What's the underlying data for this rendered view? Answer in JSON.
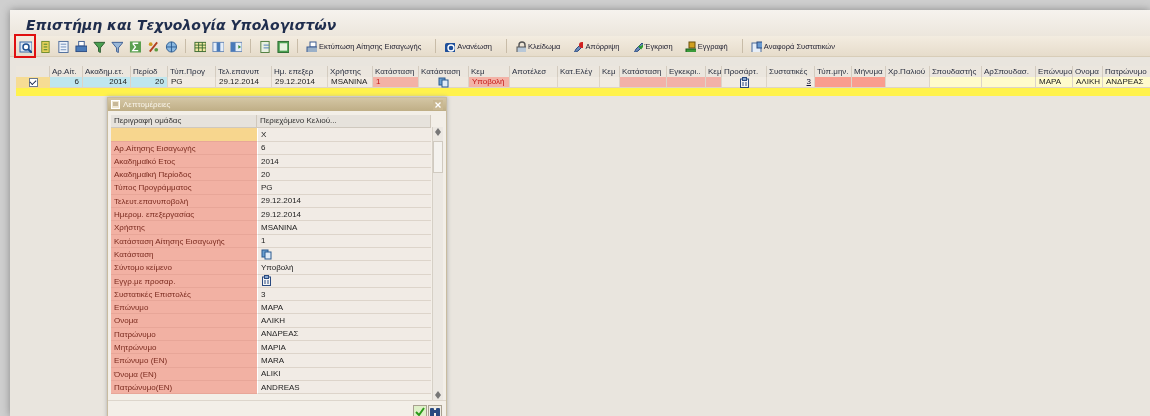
{
  "window": {
    "title": "Επιστήμη και Τεχνολογία Υπολογιστών"
  },
  "toolbar": {
    "icon_groups": [
      {
        "tools": [
          {
            "highlighted": true
          },
          {
            "highlighted": false
          },
          {
            "highlighted": false
          },
          {
            "highlighted": false
          },
          {
            "highlighted": false
          },
          {
            "highlighted": false
          },
          {
            "highlighted": false
          },
          {
            "highlighted": false
          },
          {
            "highlighted": false
          }
        ]
      },
      {
        "tools": [
          {
            "highlighted": false
          },
          {
            "highlighted": false
          },
          {
            "highlighted": false
          }
        ]
      },
      {
        "tools": [
          {
            "highlighted": false
          },
          {
            "highlighted": false
          }
        ]
      }
    ],
    "buttons": [
      {
        "kind": "print",
        "label": "Εκτύπωση Αίτησης Εισαγωγής"
      },
      {
        "kind": "refresh",
        "label": "Ανανέωση"
      },
      {
        "kind": "lock",
        "label": "Κλείδωμα"
      },
      {
        "kind": "reject",
        "label": "Απόρριψη"
      },
      {
        "kind": "approve",
        "label": "Έγκριση"
      },
      {
        "kind": "register",
        "label": "Εγγραφή"
      },
      {
        "kind": "report",
        "label": "Αναφορά Συστατικών"
      }
    ]
  },
  "table": {
    "columns": [
      "Αρ.Αίτ.",
      "Ακαδημ.ετ.",
      "Περίοδ",
      "Τύπ.Προγ",
      "Τελ.επανυπ",
      "Ημ. επεξερ",
      "Χρήστης",
      "Κατάσταση",
      "Κατάσταση",
      "Κεμ",
      "Αποτέλεσ",
      "Κατ.Ελέγ",
      "Κεμ",
      "Κατάσταση",
      "Εγκεκρι..",
      "Κεμ",
      "Προσάρτ.",
      "Συστατικές",
      "Τύπ.μην.",
      "Μήνυμα",
      "Χρ.Παλιού",
      "Σπουδαστής",
      "ΑρΣπουδασ.",
      "Επώνυμο",
      "Ονομα",
      "Πατρώνυμο"
    ],
    "rows": [
      {
        "checked": true,
        "cells": [
          {
            "kind": "number",
            "text": "6",
            "color": "#bfe6ee"
          },
          {
            "kind": "number",
            "text": "2014",
            "color": "#bfe6ee"
          },
          {
            "kind": "number",
            "text": "20",
            "color": "#bfe6ee"
          },
          {
            "kind": "text",
            "text": "PG",
            "color": "#f1ebe3"
          },
          {
            "kind": "text",
            "text": "29.12.2014",
            "color": "#f1ebe3"
          },
          {
            "kind": "text",
            "text": "29.12.2014",
            "color": "#f1ebe3"
          },
          {
            "kind": "text",
            "text": "MSANINA",
            "color": "#f1ebe3"
          },
          {
            "kind": "warning",
            "text": "1",
            "color": "#f3b2a6"
          },
          {
            "kind": "status",
            "color": "#efe8df"
          },
          {
            "kind": "warning",
            "text": "Υποβολή",
            "color": "#f3b2a6"
          },
          {
            "kind": "empty",
            "color": "#f1ebe3"
          },
          {
            "kind": "empty",
            "color": "#f1ebe3"
          },
          {
            "kind": "empty",
            "color": "#f1ebe3"
          },
          {
            "kind": "empty",
            "color": "#f2b1a8"
          },
          {
            "kind": "empty",
            "color": "#f2b1a8"
          },
          {
            "kind": "empty",
            "color": "#f2b1a8"
          },
          {
            "kind": "attachment",
            "color": "#f1ebe3"
          },
          {
            "kind": "link",
            "text": "3",
            "color": "#f1ebe3"
          },
          {
            "kind": "empty",
            "color": "#f99d8e"
          },
          {
            "kind": "empty",
            "color": "#f99d8e"
          },
          {
            "kind": "empty",
            "color": "#f1ebe3"
          },
          {
            "kind": "empty",
            "color": "#fffbcc"
          },
          {
            "kind": "empty",
            "color": "#fffbcc"
          },
          {
            "kind": "text",
            "text": "ΜΑΡΑ",
            "color": "#fffbcc"
          },
          {
            "kind": "text",
            "text": "ΑΛΙΚΗ",
            "color": "#fffbcc"
          },
          {
            "kind": "text",
            "text": "ΑΝΔΡΕΑΣ",
            "color": "#fffbcc"
          }
        ]
      }
    ]
  },
  "dialog": {
    "title": "Λεπτομέρειες",
    "columns": [
      "Περιγραφή ομάδας",
      "Περιεχόμενο Κελιού..."
    ],
    "rows": [
      {
        "selected": true,
        "kind": "text",
        "value": "X"
      },
      {
        "selected": false,
        "kind": "text",
        "label": "Αρ.Αίτησης Εισαγωγής",
        "value": "6"
      },
      {
        "selected": false,
        "kind": "text",
        "label": "Ακαδημαϊκό Ετος",
        "value": "2014"
      },
      {
        "selected": false,
        "kind": "text",
        "label": "Ακαδημαϊκή Περίοδος",
        "value": "20"
      },
      {
        "selected": false,
        "kind": "text",
        "label": "Τύπος Προγράμματος",
        "value": "PG"
      },
      {
        "selected": false,
        "kind": "text",
        "label": "Τελευτ.επανυποβολή",
        "value": "29.12.2014"
      },
      {
        "selected": false,
        "kind": "text",
        "label": "Ημερομ. επεξεργασίας",
        "value": "29.12.2014"
      },
      {
        "selected": false,
        "kind": "text",
        "label": "Χρήστης",
        "value": "MSANINA"
      },
      {
        "selected": false,
        "kind": "text",
        "label": "Κατάσταση Αίτησης Εισαγωγής",
        "value": "1"
      },
      {
        "selected": false,
        "kind": "status",
        "label": "Κατάσταση"
      },
      {
        "selected": false,
        "kind": "text",
        "label": "Σύντομο κείμενο",
        "value": "Υποβολή"
      },
      {
        "selected": false,
        "kind": "attachment",
        "label": "Εγγρ.με προσαρ."
      },
      {
        "selected": false,
        "kind": "text",
        "label": "Συστατικές Επιστολές",
        "value": "3"
      },
      {
        "selected": false,
        "kind": "text",
        "label": "Επώνυμο",
        "value": "ΜΑΡΑ"
      },
      {
        "selected": false,
        "kind": "text",
        "label": "Ονομα",
        "value": "ΑΛΙΚΗ"
      },
      {
        "selected": false,
        "kind": "text",
        "label": "Πατρώνυμο",
        "value": "ΑΝΔΡΕΑΣ"
      },
      {
        "selected": false,
        "kind": "text",
        "label": "Μητρώνυμο",
        "value": "ΜΑΡΙΑ"
      },
      {
        "selected": false,
        "kind": "text",
        "label": "Επώνυμο (EN)",
        "value": "MARA"
      },
      {
        "selected": false,
        "kind": "text",
        "label": "Όνομα (EN)",
        "value": "ALIKI"
      },
      {
        "selected": false,
        "kind": "text",
        "label": "Πατρώνυμο(EN)",
        "value": "ANDREAS"
      }
    ]
  }
}
